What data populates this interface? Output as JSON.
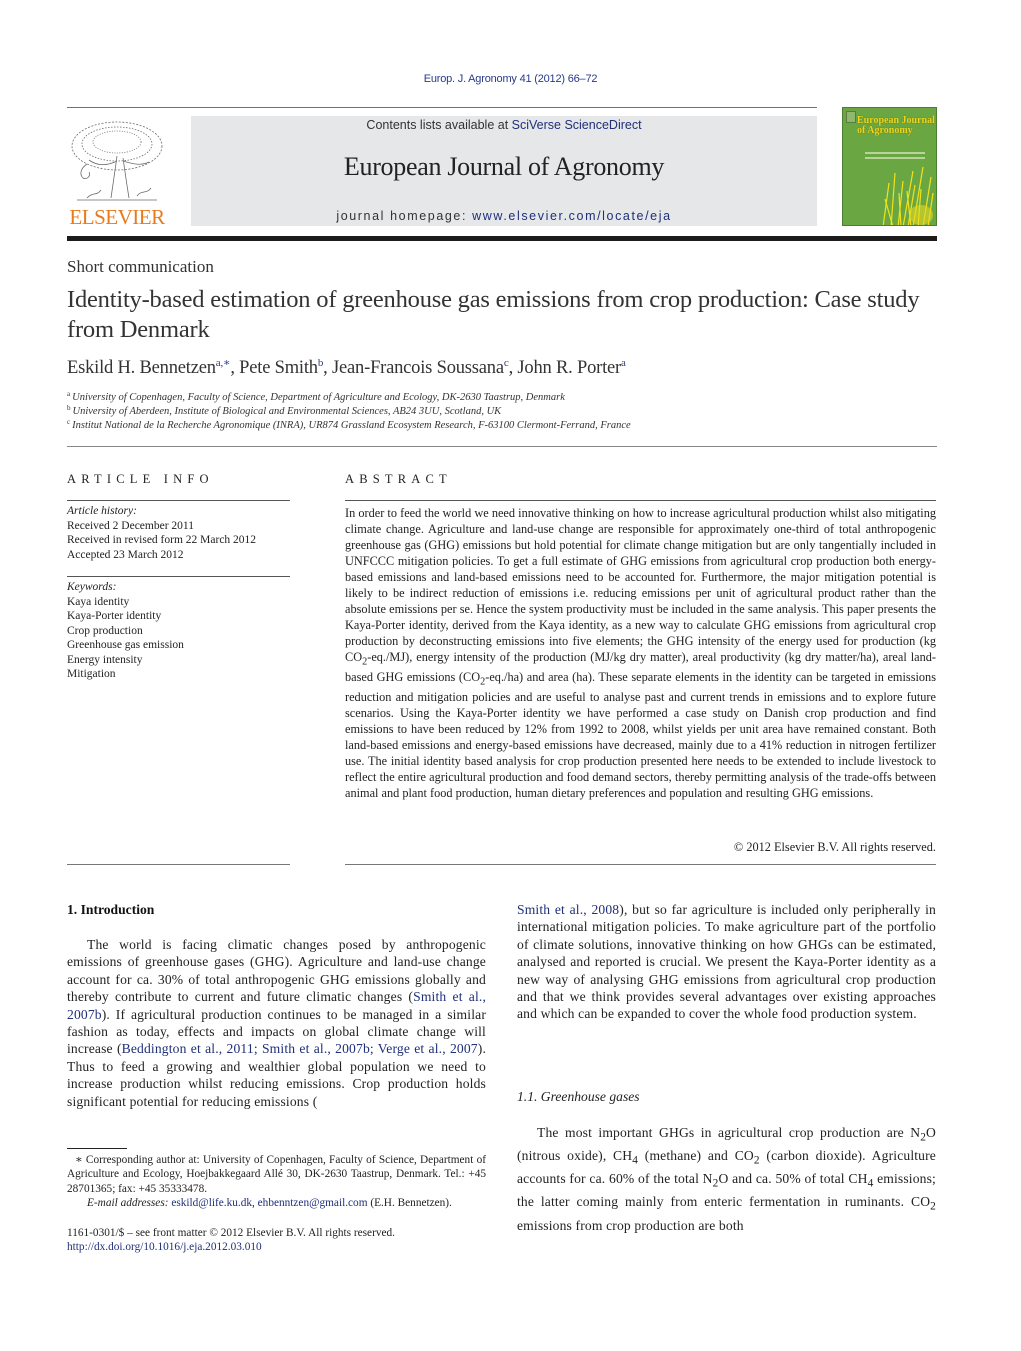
{
  "header": {
    "citation": "Europ. J. Agronomy 41 (2012) 66–72",
    "publisher_logo_text": "ELSEVIER",
    "contents_prefix": "Contents lists available at ",
    "contents_link": "SciVerse ScienceDirect",
    "journal_title": "European Journal of Agronomy",
    "homepage_prefix": "journal homepage: ",
    "homepage_link": "www.elsevier.com/locate/eja",
    "cover_title": "European Journal of Agronomy",
    "colors": {
      "link": "#1f2f7a",
      "elsevier_orange": "#e87a1e",
      "banner_bg": "#e6e7e9",
      "cover_green": "#6aa743",
      "cover_yellow": "#e8d820"
    }
  },
  "article": {
    "type": "Short communication",
    "title": "Identity-based estimation of greenhouse gas emissions from crop production: Case study from Denmark",
    "authors": [
      {
        "name": "Eskild H. Bennetzen",
        "sup": "a,∗",
        "sep": ", "
      },
      {
        "name": "Pete Smith",
        "sup": "b",
        "sep": ", "
      },
      {
        "name": "Jean-Francois Soussana",
        "sup": "c",
        "sep": ", "
      },
      {
        "name": "John R. Porter",
        "sup": "a",
        "sep": ""
      }
    ],
    "affiliations": [
      {
        "sup": "a",
        "text": "University of Copenhagen, Faculty of Science, Department of Agriculture and Ecology, DK-2630 Taastrup, Denmark"
      },
      {
        "sup": "b",
        "text": "University of Aberdeen, Institute of Biological and Environmental Sciences, AB24 3UU, Scotland, UK"
      },
      {
        "sup": "c",
        "text": "Institut National de la Recherche Agronomique (INRA), UR874 Grassland Ecosystem Research, F-63100 Clermont-Ferrand, France"
      }
    ]
  },
  "article_info": {
    "heading": "ARTICLE INFO",
    "history_label": "Article history:",
    "history": [
      "Received 2 December 2011",
      "Received in revised form 22 March 2012",
      "Accepted 23 March 2012"
    ],
    "keywords_label": "Keywords:",
    "keywords": [
      "Kaya identity",
      "Kaya-Porter identity",
      "Crop production",
      "Greenhouse gas emission",
      "Energy intensity",
      "Mitigation"
    ]
  },
  "abstract": {
    "heading": "ABSTRACT",
    "text_1": "In order to feed the world we need innovative thinking on how to increase agricultural production whilst also mitigating climate change. Agriculture and land-use change are responsible for approximately one-third of total anthropogenic greenhouse gas (GHG) emissions but hold potential for climate change mitigation but are only tangentially included in UNFCCC mitigation policies. To get a full estimate of GHG emissions from agricultural crop production both energy-based emissions and land-based emissions need to be accounted for. Furthermore, the major mitigation potential is likely to be indirect reduction of emissions i.e. reducing emissions per unit of agricultural product rather than the absolute emissions per se. Hence the system productivity must be included in the same analysis. This paper presents the Kaya-Porter identity, derived from the Kaya identity, as a new way to calculate GHG emissions from agricultural crop production by deconstructing emissions into five elements; the GHG intensity of the energy used for production (kg CO",
    "sub_2a": "2",
    "text_2": "-eq./MJ), energy intensity of the production (MJ/kg dry matter), areal productivity (kg dry matter/ha), areal land-based GHG emissions (CO",
    "sub_2b": "2",
    "text_3": "-eq./ha) and area (ha). These separate elements in the identity can be targeted in emissions reduction and mitigation policies and are useful to analyse past and current trends in emissions and to explore future scenarios. Using the Kaya-Porter identity we have performed a case study on Danish crop production and find emissions to have been reduced by 12% from 1992 to 2008, whilst yields per unit area have remained constant. Both land-based emissions and energy-based emissions have decreased, mainly due to a 41% reduction in nitrogen fertilizer use. The initial identity based analysis for crop production presented here needs to be extended to include livestock to reflect the entire agricultural production and food demand sectors, thereby permitting analysis of the trade-offs between animal and plant food production, human dietary preferences and population and resulting GHG emissions.",
    "copyright": "© 2012 Elsevier B.V. All rights reserved."
  },
  "introduction": {
    "heading": "1.  Introduction",
    "p1_a": "The world is facing climatic changes posed by anthropogenic emissions of greenhouse gases (GHG). Agriculture and land-use change account for ca. 30% of total anthropogenic GHG emissions globally and thereby contribute to current and future climatic changes (",
    "ref_1": "Smith et al., 2007b",
    "p1_b": "). If agricultural production continues to be managed in a similar fashion as today, effects and impacts on global climate change will increase (",
    "ref_2": "Beddington et al., 2011; Smith et al., 2007b; Verge et al., 2007",
    "p1_c": "). Thus to feed a growing and wealthier global population we need to increase production whilst reducing emissions. Crop production holds significant potential for reducing emissions (",
    "ref_3": "Smith et al., 2008",
    "p1_d": "), but so far agriculture is included only peripherally in international mitigation policies. To make agriculture part of the portfolio of climate solutions, innovative thinking on how GHGs can be estimated, analysed and reported is crucial. We present the Kaya-Porter identity as a new way of analysing GHG emissions from agricultural crop production and that we think provides several advantages over existing approaches and which can be expanded to cover the whole food production system."
  },
  "subsection": {
    "heading": "1.1.  Greenhouse gases",
    "t1": "The most important GHGs in agricultural crop production are N",
    "s1": "2",
    "t2": "O (nitrous oxide), CH",
    "s2": "4",
    "t3": " (methane) and CO",
    "s3": "2",
    "t4": " (carbon dioxide). Agriculture accounts for ca. 60% of the total N",
    "s4": "2",
    "t5": "O and ca. 50% of total CH",
    "s5": "4",
    "t6": " emissions; the latter coming mainly from enteric fermentation in ruminants. CO",
    "s6": "2",
    "t7": " emissions from crop production are both"
  },
  "footnote": {
    "corresponding": "∗ Corresponding author at: University of Copenhagen, Faculty of Science, Department of Agriculture and Ecology, Hoejbakkegaard Allé 30, DK-2630 Taastrup, Denmark. Tel.: +45 28701365; fax: +45 35333478.",
    "email_label": "E-mail addresses:",
    "email_1": "eskild@life.ku.dk",
    "email_sep": ", ",
    "email_2": "ehbenntzen@gmail.com",
    "email_suffix": " (E.H. Bennetzen).",
    "issn_line": "1161-0301/$ – see front matter © 2012 Elsevier B.V. All rights reserved.",
    "doi": "http://dx.doi.org/10.1016/j.eja.2012.03.010"
  }
}
